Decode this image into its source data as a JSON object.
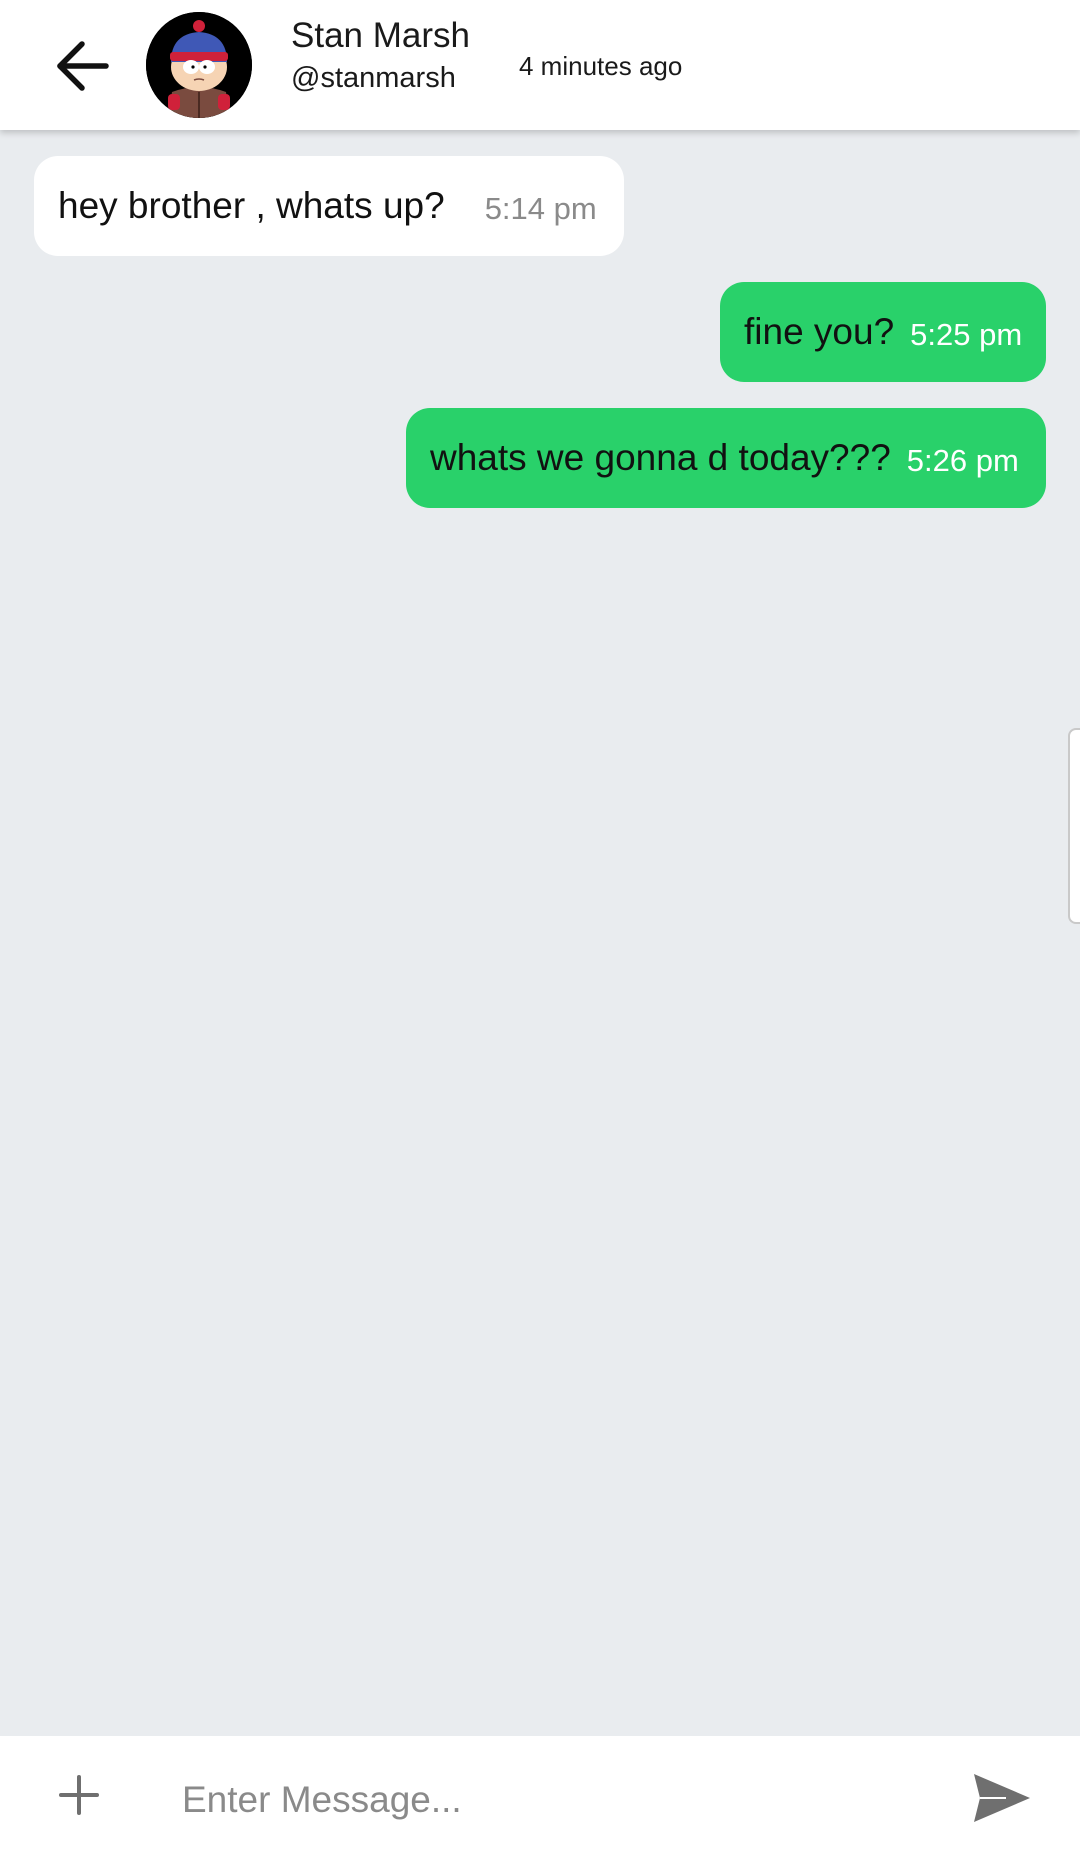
{
  "header": {
    "back_icon": "arrow-left-icon",
    "avatar_icon": "stan-marsh-avatar",
    "contact_name": "Stan Marsh",
    "contact_handle": "@stanmarsh",
    "last_seen": "4 minutes ago"
  },
  "messages": [
    {
      "direction": "incoming",
      "text": "hey brother , whats up?",
      "time": "5:14 pm"
    },
    {
      "direction": "outgoing",
      "text": "fine you?",
      "time": "5:25 pm"
    },
    {
      "direction": "outgoing",
      "text": "whats we gonna d today???",
      "time": "5:26 pm"
    }
  ],
  "composer": {
    "add_icon": "plus-icon",
    "placeholder": "Enter Message...",
    "value": "",
    "send_icon": "send-icon"
  },
  "colors": {
    "outgoing_bubble": "#29d16a",
    "incoming_bubble": "#ffffff",
    "background": "#e9ecef",
    "timestamp_gray": "#8a8a8a"
  }
}
